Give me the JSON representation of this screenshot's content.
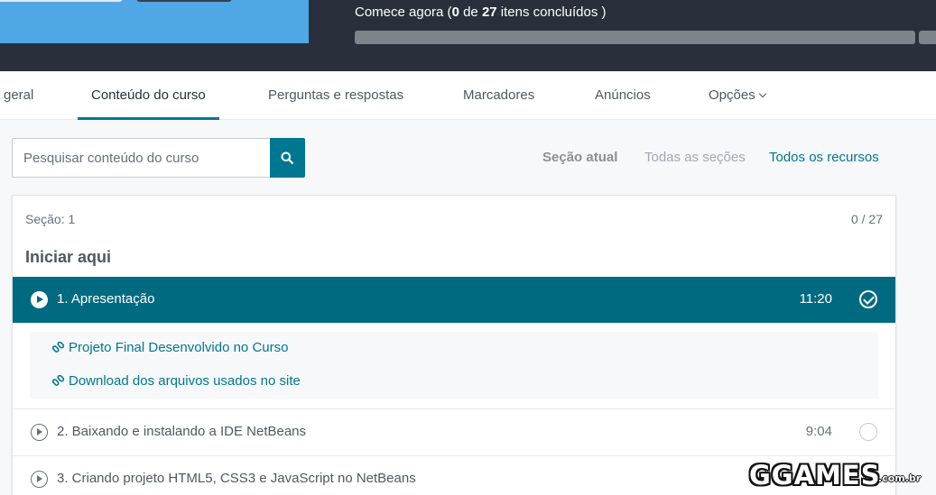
{
  "header": {
    "progress_prefix": "Comece agora (",
    "completed": "0",
    "progress_mid": " de ",
    "total": "27",
    "progress_suffix": " itens concluídos   )",
    "progress_fraction": 0
  },
  "tabs": [
    {
      "label": "geral",
      "active": false
    },
    {
      "label": "Conteúdo do curso",
      "active": true
    },
    {
      "label": "Perguntas e respostas",
      "active": false
    },
    {
      "label": "Marcadores",
      "active": false
    },
    {
      "label": "Anúncios",
      "active": false
    },
    {
      "label": "Opções",
      "active": false
    }
  ],
  "search": {
    "placeholder": "Pesquisar conteúdo do curso",
    "icon": "search-icon"
  },
  "filters": {
    "current": "Seção atual",
    "all": "Todas as seções",
    "resources": "Todos os recursos"
  },
  "section": {
    "label": "Seção: 1",
    "count": "0 / 27",
    "title": "Iniciar aqui"
  },
  "lectures": [
    {
      "title": "1. Apresentação",
      "duration": "11:20",
      "active": true,
      "resources": [
        {
          "label": "Projeto Final Desenvolvido no Curso",
          "icon": "link-icon"
        },
        {
          "label": "Download dos arquivos usados no site",
          "icon": "link-icon"
        }
      ]
    },
    {
      "title": "2. Baixando e instalando a IDE NetBeans",
      "duration": "9:04",
      "active": false
    },
    {
      "title": "3. Criando projeto HTML5, CSS3 e JavaScript no NetBeans",
      "duration": "",
      "active": false
    }
  ],
  "watermark": {
    "main": "GGAMES",
    "sub": ".com.br"
  },
  "colors": {
    "accent": "#007791",
    "active_row": "#006a80",
    "topbar": "#29303b"
  }
}
